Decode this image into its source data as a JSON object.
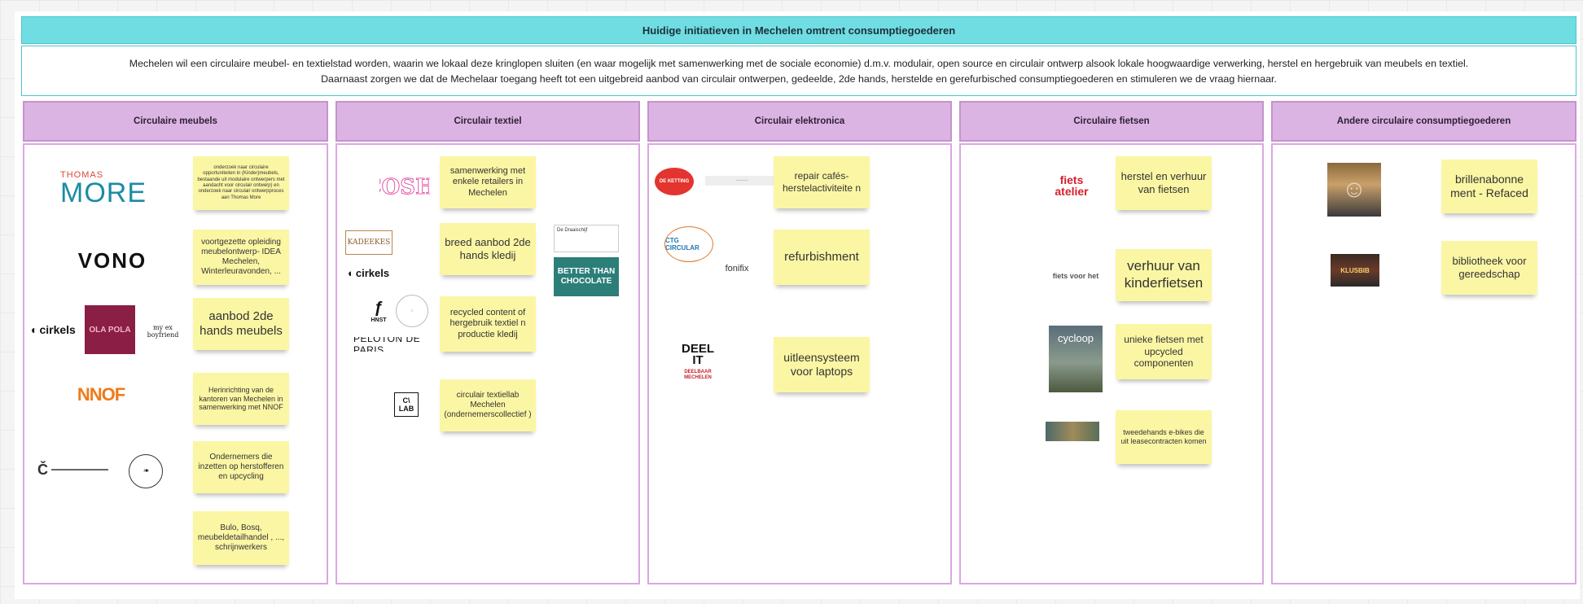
{
  "board": {
    "title": "Huidige initiatieven in Mechelen omtrent consumptiegoederen",
    "description_line1": "Mechelen wil een circulaire meubel- en textielstad worden, waarin we lokaal deze kringlopen sluiten (en waar mogelijk met samenwerking met de sociale economie) d.m.v. modulair, open source en circulair ontwerp alsook lokale hoogwaardige verwerking, herstel en hergebruik van meubels en textiel.",
    "description_line2": "Daarnaast zorgen we dat de Mechelaar toegang heeft tot een uitgebreid aanbod van circulair ontwerpen, gedeelde, 2de hands, herstelde en gerefurbisched consumptiegoederen en stimuleren we de vraag hiernaar."
  },
  "columns": [
    {
      "title": "Circulaire meubels"
    },
    {
      "title": "Circulair textiel"
    },
    {
      "title": "Circulair elektronica"
    },
    {
      "title": "Circulaire fietsen"
    },
    {
      "title": "Andere circulaire consumptiegoederen"
    }
  ],
  "notes": {
    "meubels": [
      "onderzoek naar circulaire opportuniteiten in (Kinder)meubels, bestaande uit modulaire ontwerpers met aandacht voor circulair ontwerp) en onderzoek naar circulair ontwerpproces aan Thomas More",
      "voortgezette opleiding meubelontwerp- IDEA Mechelen, Winterleuravonden, ...",
      "aanbod 2de hands meubels",
      "Herinrichting van de kantoren van Mechelen in samenwerking met NNOF",
      "Ondernemers die inzetten op herstofferen en upcycling",
      "Bulo, Bosq, meubeldetailhandel , ..., schrijnwerkers"
    ],
    "textiel": [
      "samenwerking met enkele retailers in Mechelen",
      "breed aanbod 2de hands kledij",
      "recycled content of hergebruik textiel n productie kledij",
      "circulair textiellab Mechelen (ondernemerscollectief )"
    ],
    "elektronica": [
      "repair cafés- herstelactiviteite n",
      "refurbishment",
      "uitleensysteem voor laptops"
    ],
    "fietsen": [
      "herstel en verhuur van fietsen",
      "verhuur van kinderfietsen",
      "unieke fietsen met upcycled componenten",
      "tweedehands e-bikes die uit leasecontracten komen"
    ],
    "andere": [
      "brillenabonne ment - Refaced",
      "bibliotheek voor gereedschap"
    ]
  },
  "logos": {
    "thomas_more_top": "THOMAS",
    "thomas_more_bottom": "MORE",
    "vono": "VONO",
    "cirkels": "cirkels",
    "ola_pola": "OLA POLA",
    "my_ex_boyfriend": "my ex boyfriend",
    "nnof": "NNOF",
    "cosh": "COSH!",
    "kadeekes": "KADEEKES",
    "hnst": "HNST",
    "peloton": "PELOTON DE PARIS",
    "clab": "C\\ LAB",
    "de_draaischijf": "De Draaischijf",
    "better_than_chocolate": "BETTER THAN CHOCOLATE",
    "de_ketting": "DE KETTING",
    "ctg_circular": "CTG CIRCULAR",
    "fonifix": "fonifix",
    "deel_it": "DEEL IT",
    "deelbaar_mechelen": "DEELBAAR MECHELEN",
    "fietsatelier": "fiets atelier",
    "fietsvoorhet": "fiets voor het",
    "cycloop": "cycloop",
    "klusbib": "KLUSBIB"
  },
  "colors": {
    "title_bg": "#6fdde2",
    "column_header_bg": "#dcb4e3",
    "sticky_note": "#fbf6a4"
  }
}
